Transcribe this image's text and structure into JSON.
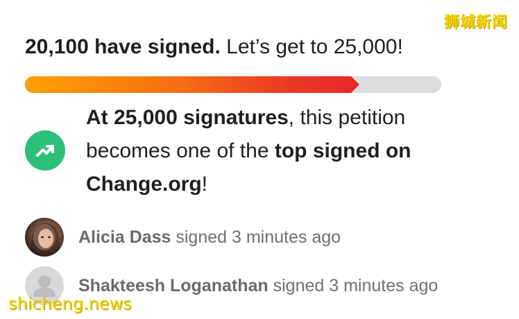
{
  "watermarks": {
    "top": "狮城新闻",
    "bottom": "shicheng.news"
  },
  "progress": {
    "count_text": "20,100 have signed.",
    "goal_text": "Let’s get to 25,000!",
    "signed": 20100,
    "goal": 25000,
    "fill_fraction": 0.804,
    "colors": {
      "start": "#ffa000",
      "end": "#e8292a",
      "track": "#dcdcdc"
    }
  },
  "milestone": {
    "icon": "trending-up-icon",
    "icon_color": "#2bbf7a",
    "part1_bold": "At 25,000 signatures",
    "part2": ", this petition becomes one of the ",
    "part3_bold": "top signed on Change.org",
    "part4": "!"
  },
  "recent_signers": [
    {
      "name": "Alicia Dass",
      "action": "signed",
      "time": "3 minutes ago",
      "avatar": "photo"
    },
    {
      "name": "Shakteesh Loganathan",
      "action": "signed",
      "time": "3 minutes ago",
      "avatar": "default-person-icon"
    }
  ]
}
